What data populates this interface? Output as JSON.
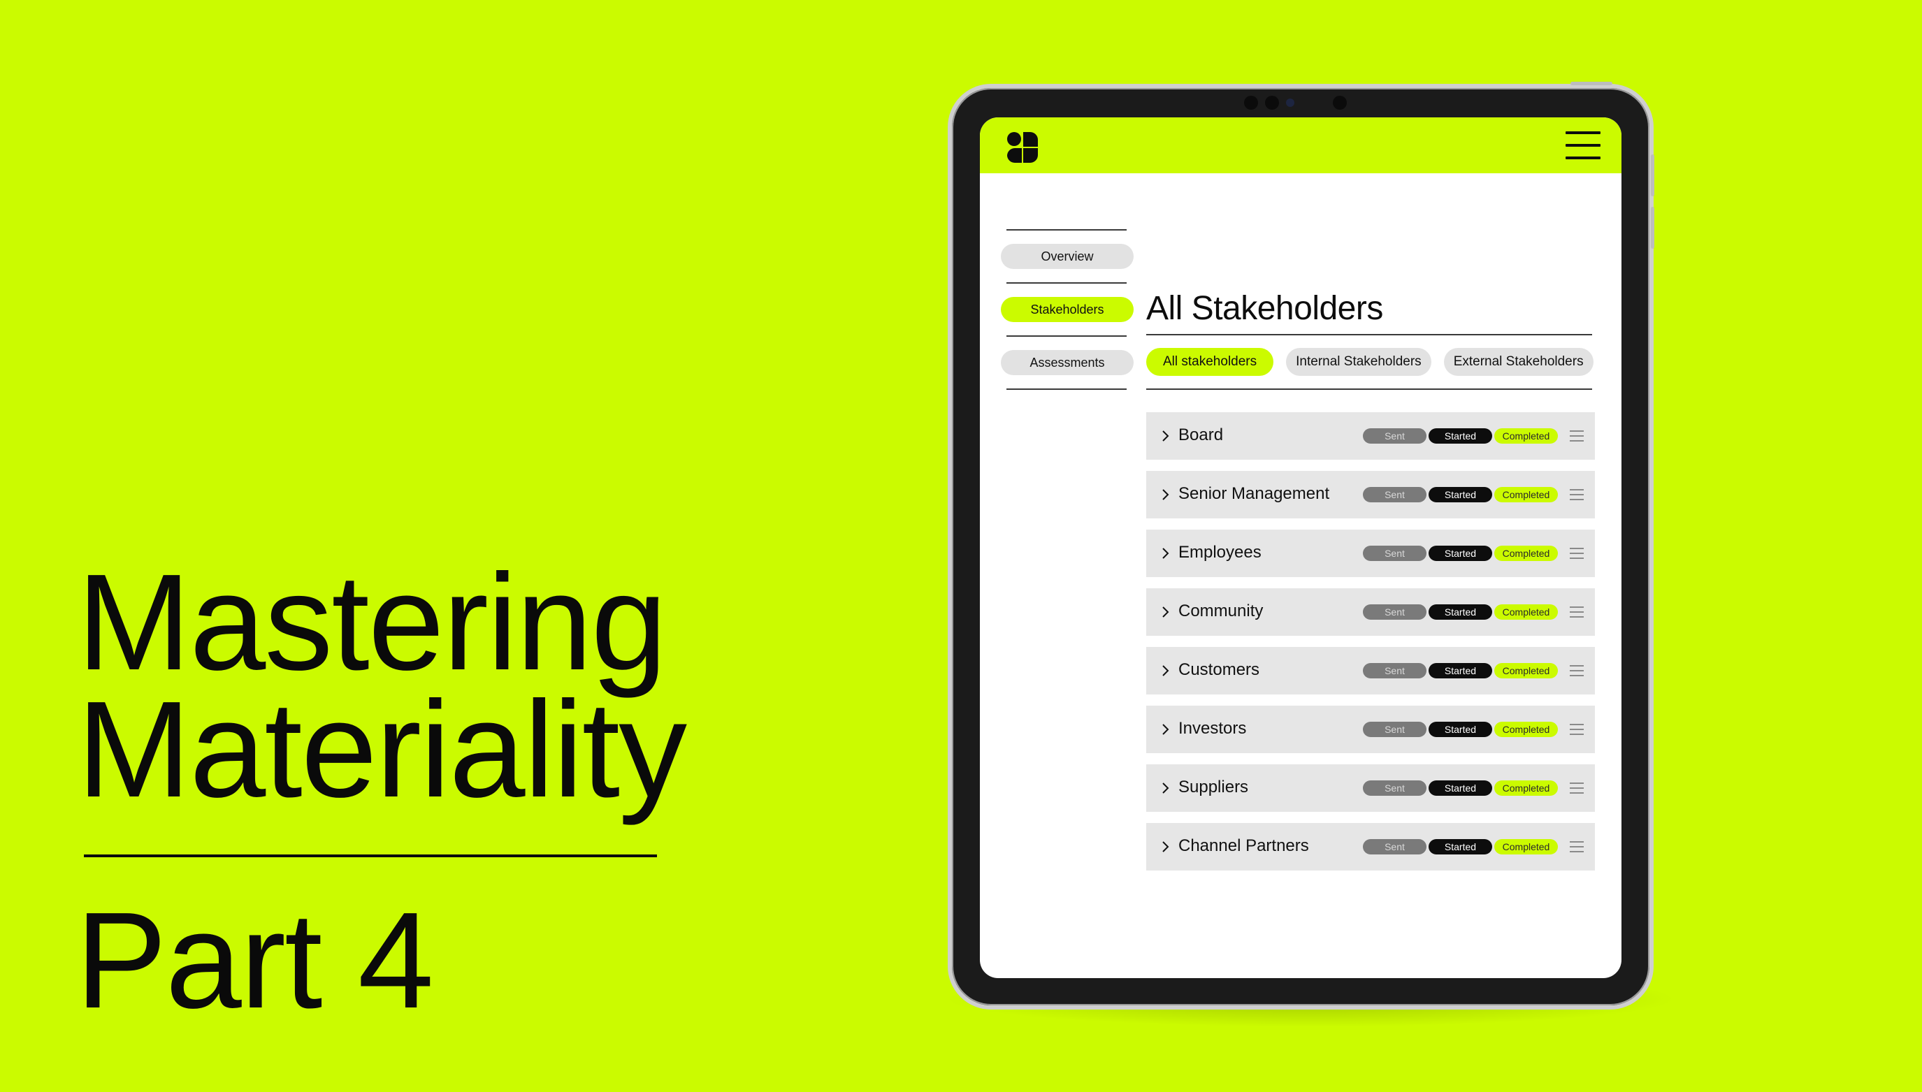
{
  "hero": {
    "title_line1": "Mastering",
    "title_line2": "Materiality",
    "part": "Part 4"
  },
  "app": {
    "logo_icon": "brand-logo-icon",
    "menu_icon": "hamburger-menu-icon",
    "accent_color": "#cbfb00"
  },
  "sidebar": {
    "items": [
      {
        "label": "Overview",
        "active": false
      },
      {
        "label": "Stakeholders",
        "active": true
      },
      {
        "label": "Assessments",
        "active": false
      }
    ]
  },
  "main": {
    "title": "All Stakeholders",
    "filters": [
      {
        "label": "All stakeholders",
        "active": true
      },
      {
        "label": "Internal Stakeholders",
        "active": false
      },
      {
        "label": "External Stakeholders",
        "active": false
      }
    ],
    "status_labels": {
      "sent": "Sent",
      "started": "Started",
      "completed": "Completed"
    },
    "rows": [
      {
        "name": "Board"
      },
      {
        "name": "Senior Management"
      },
      {
        "name": "Employees"
      },
      {
        "name": "Community"
      },
      {
        "name": "Customers"
      },
      {
        "name": "Investors"
      },
      {
        "name": "Suppliers"
      },
      {
        "name": "Channel Partners"
      }
    ]
  }
}
